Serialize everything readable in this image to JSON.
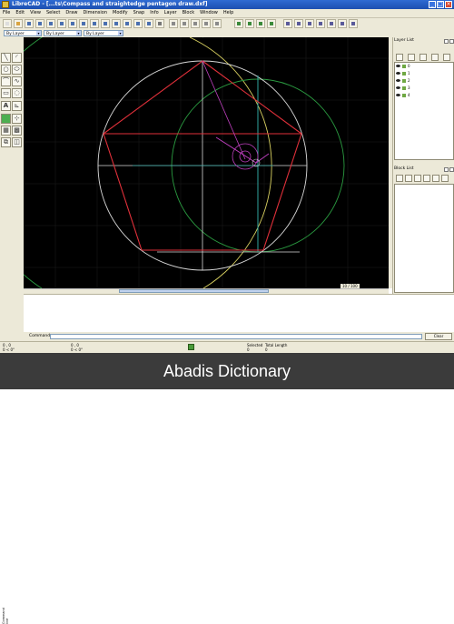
{
  "window": {
    "app_title": "LibreCAD - [...ts\\Compass and straightedge pentagon draw.dxf]",
    "controls": [
      "_",
      "□",
      "×"
    ]
  },
  "menu": {
    "items": [
      "File",
      "Edit",
      "View",
      "Select",
      "Draw",
      "Dimension",
      "Modify",
      "Snap",
      "Info",
      "Layer",
      "Block",
      "Window",
      "Help"
    ]
  },
  "pen_toolbar": {
    "color": "By Layer",
    "width": "By Layer",
    "linetype": "By Layer"
  },
  "left_tools": {
    "text_tool_glyph": "A"
  },
  "drawing": {
    "zoom_readout": "10 / 100",
    "colors": {
      "background": "#000000",
      "white_lines": "#d8d8d8",
      "red_lines": "#e0303a",
      "green_lines": "#2a9a40",
      "cyan_lines": "#30a6a0",
      "yellow_lines": "#d8d060",
      "magenta_lines": "#c040c0"
    }
  },
  "layer_list": {
    "title": "Layer List",
    "layers": [
      "0",
      "1",
      "2",
      "3",
      "4"
    ]
  },
  "block_list": {
    "title": "Block List"
  },
  "command_line": {
    "side_label": "Command line",
    "prompt_label": "Command:",
    "clear_label": "Clear"
  },
  "status": {
    "abs_coord": "0 , 0",
    "abs_polar": "0 < 0°",
    "rel_coord": "0 , 0",
    "rel_polar": "0 < 0°",
    "selected_label": "Selected",
    "selected_value": "0",
    "length_label": "Total Length",
    "length_value": "0"
  },
  "watermark": {
    "text": "Abadis Dictionary"
  }
}
